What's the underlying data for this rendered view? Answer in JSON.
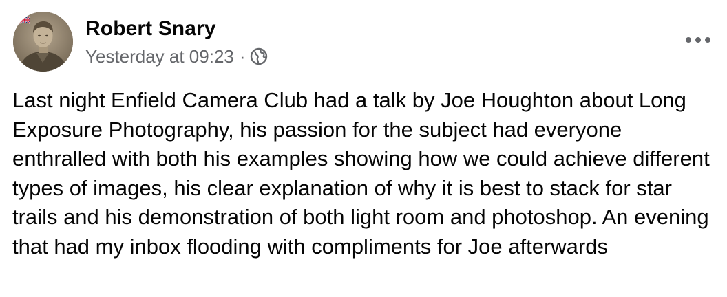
{
  "post": {
    "author": "Robert Snary",
    "timestamp": "Yesterday at 09:23",
    "separator": "·",
    "audience_icon": "globe-icon",
    "more_icon": "more-options-icon",
    "text": "Last night Enfield Camera Club had a talk by Joe Houghton about Long Exposure Photography, his passion for the subject had everyone enthralled with both his examples showing how we could achieve different types of images, his clear explanation of why it is best to stack for star trails and his demonstration of both light room and photoshop. An evening that had my inbox flooding with compliments for Joe afterwards"
  },
  "colors": {
    "text_primary": "#050505",
    "text_secondary": "#65676b",
    "background": "#ffffff"
  }
}
